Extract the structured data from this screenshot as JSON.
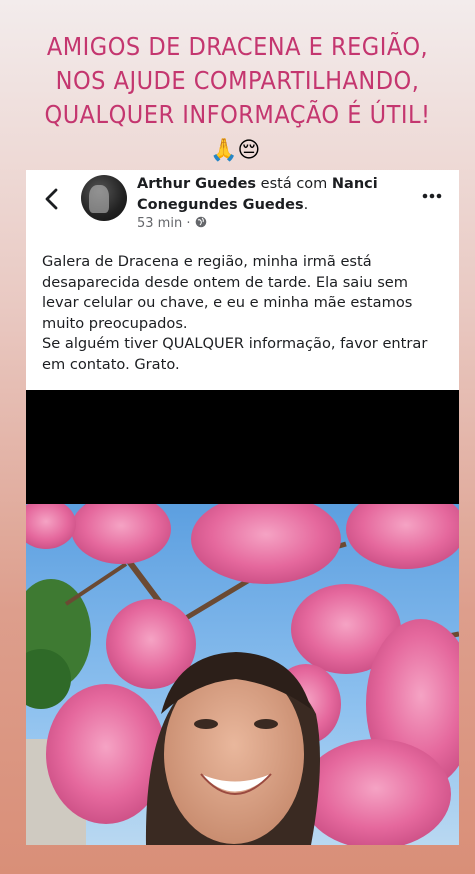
{
  "story": {
    "caption_lines": [
      "AMIGOS  DE DRACENA E REGIÃO,",
      "NOS AJUDE COMPARTILHANDO,",
      "QUALQUER INFORMAÇÃO É ÚTIL!"
    ],
    "emojis": "🙏😔"
  },
  "post": {
    "back_icon": "chevron-left-icon",
    "author": "Arthur Guedes",
    "with_text": "está com",
    "tagged": "Nanci Conegundes Guedes",
    "tagged_suffix": ".",
    "time": "53 min",
    "privacy_icon": "globe-icon",
    "more_icon": "more-horizontal-icon",
    "body_lines": [
      "Galera de Dracena e região, minha irmã está",
      "desaparecida desde ontem de tarde. Ela saiu sem",
      "levar celular ou chave, e eu e minha mãe estamos",
      "muito preocupados.",
      "Se alguém tiver QUALQUER informação, favor entrar",
      "em contato. Grato."
    ]
  },
  "colors": {
    "caption": "#c4366f",
    "blossom": "#e46aa0",
    "sky": "#6aa7e3"
  }
}
